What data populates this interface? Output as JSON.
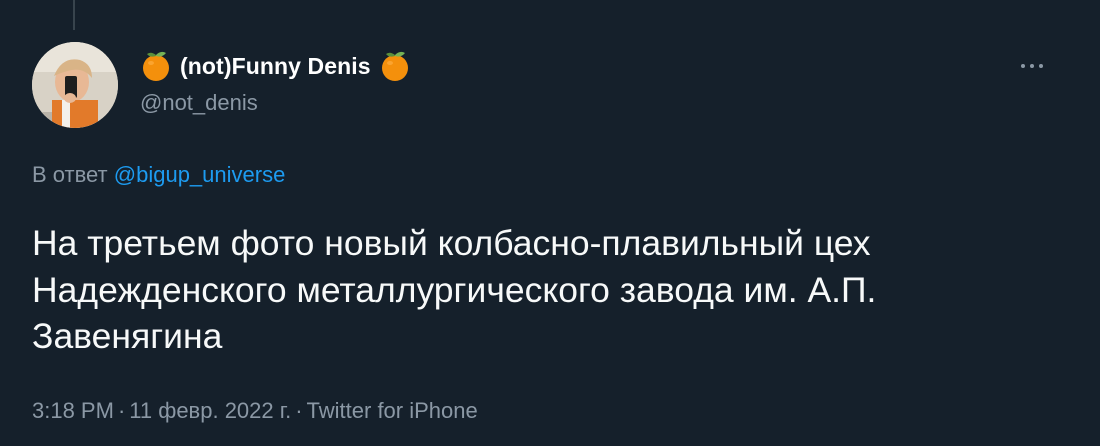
{
  "tweet": {
    "display_name": "(not)Funny Denis",
    "handle": "@not_denis",
    "name_emoji_icon": "orange-tangerine-icon",
    "reply_prefix": "В ответ",
    "reply_mention": "@bigup_universe",
    "text": "На третьем фото новый колбасно-плавильный цех Надежденского металлургического завода им. А.П. Завенягина",
    "time": "3:18 PM",
    "separator": "·",
    "date": "11 февр. 2022 г.",
    "source": "Twitter for iPhone"
  },
  "colors": {
    "background": "#15202b",
    "text_primary": "#f7f9f9",
    "text_secondary": "#8b98a5",
    "accent": "#1d9bf0",
    "thread_line": "#38444d"
  }
}
